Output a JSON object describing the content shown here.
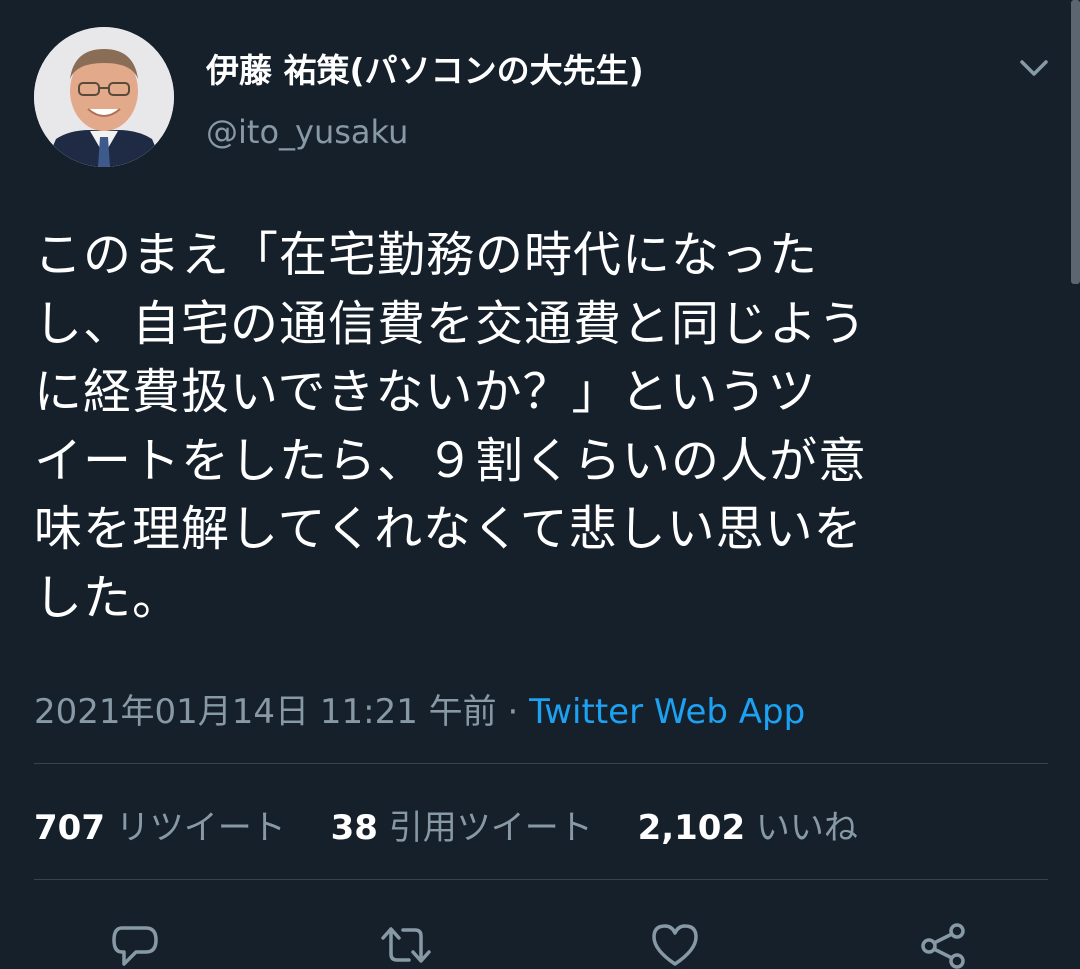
{
  "user": {
    "display_name": "伊藤 祐策(パソコンの大先生)",
    "handle": "@ito_yusaku"
  },
  "tweet": {
    "text": "このまえ「在宅勤務の時代になった\nし、自宅の通信費を交通費と同じよう\nに経費扱いできないか？」というツ\nイートをしたら、９割くらいの人が意\n味を理解してくれなくて悲しい思いを\nした。",
    "timestamp": "2021年01月14日 11:21 午前",
    "separator": " · ",
    "source": "Twitter Web App"
  },
  "stats": {
    "retweets_count": "707",
    "retweets_label": "リツイート",
    "quotes_count": "38",
    "quotes_label": "引用ツイート",
    "likes_count": "2,102",
    "likes_label": "いいね"
  },
  "icons": {
    "more": "chevron-down-icon",
    "reply": "reply-icon",
    "retweet": "retweet-icon",
    "like": "heart-icon",
    "share": "share-icon"
  },
  "colors": {
    "background": "#15202b",
    "text": "#ffffff",
    "secondary": "#8899a6",
    "accent": "#1da1f2",
    "divider": "#38444d"
  }
}
